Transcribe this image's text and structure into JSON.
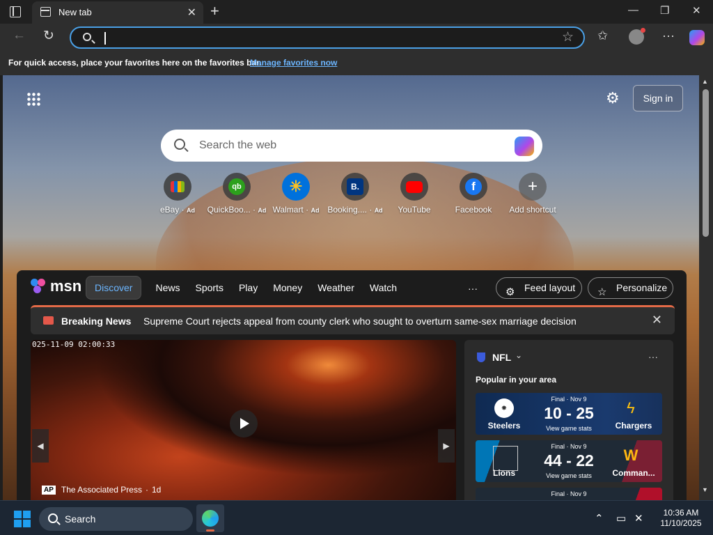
{
  "browser": {
    "tab_title": "New tab",
    "address_value": "",
    "favbar_text": "For quick access, place your favorites here on the favorites bar.",
    "favbar_link": "Manage favorites now"
  },
  "ntp": {
    "sign_in": "Sign in",
    "search_placeholder": "Search the web",
    "shortcuts": [
      {
        "label": "eBay",
        "ad": "Ad",
        "icon": "ebay-icon",
        "color": "#2e2e2e"
      },
      {
        "label": "QuickBoo...",
        "ad": "Ad",
        "icon": "quickbooks-icon",
        "color": "#2ca01c"
      },
      {
        "label": "Walmart",
        "ad": "Ad",
        "icon": "walmart-icon",
        "color": "#0071dc"
      },
      {
        "label": "Booking....",
        "ad": "Ad",
        "icon": "booking-icon",
        "color": "#003580"
      },
      {
        "label": "YouTube",
        "ad": "",
        "icon": "youtube-icon",
        "color": "#ff0000"
      },
      {
        "label": "Facebook",
        "ad": "",
        "icon": "facebook-icon",
        "color": "#1877f2"
      },
      {
        "label": "Add shortcut",
        "ad": "",
        "icon": "add-icon",
        "color": "#3c3c3c"
      }
    ]
  },
  "msn": {
    "logo": "msn",
    "nav": [
      "Discover",
      "News",
      "Sports",
      "Play",
      "Money",
      "Weather",
      "Watch"
    ],
    "more": "···",
    "feed_layout": "Feed layout",
    "personalize": "Personalize",
    "breaking_title": "Breaking News",
    "breaking_text": "Supreme Court rejects appeal from county clerk who sought to overturn same-sex marriage decision",
    "video": {
      "timestamp": "025-11-09 02:00:33",
      "source_badge": "AP",
      "source": "The Associated Press",
      "age": "1d"
    },
    "nfl": {
      "title": "NFL",
      "subtitle": "Popular in your area",
      "games": [
        {
          "status": "Final · Nov 9",
          "home": "Steelers",
          "away": "Chargers",
          "score": "10 - 25",
          "stats": "View game stats",
          "bg": "#1a3a6e"
        },
        {
          "status": "Final · Nov 9",
          "home": "Lions",
          "away": "Comman...",
          "score": "44 - 22",
          "stats": "View game stats",
          "bg": "#5a1f2a"
        },
        {
          "status": "Final · Nov 9",
          "home": "",
          "away": "",
          "score": "",
          "stats": "",
          "bg": "#4a2a1a"
        }
      ]
    }
  },
  "taskbar": {
    "search_label": "Search",
    "time": "10:36 AM",
    "date": "11/10/2025"
  }
}
